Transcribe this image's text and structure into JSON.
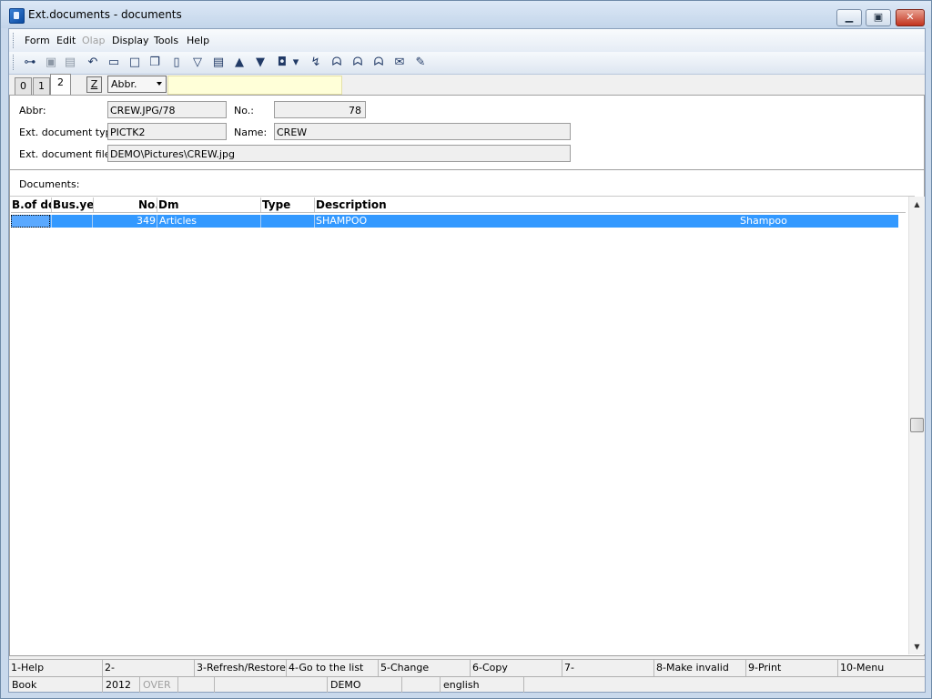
{
  "window": {
    "title": "Ext.documents - documents",
    "min_glyph": "▁",
    "max_glyph": "▣",
    "close_glyph": "✕"
  },
  "menu": [
    {
      "label": "Form",
      "enabled": true
    },
    {
      "label": "Edit",
      "enabled": true
    },
    {
      "label": "Olap",
      "enabled": false
    },
    {
      "label": "Display",
      "enabled": true
    },
    {
      "label": "Tools",
      "enabled": true
    },
    {
      "label": "Help",
      "enabled": true
    }
  ],
  "toolbar": [
    {
      "icon": "tree-icon",
      "glyph": "⊶"
    },
    {
      "icon": "save-icon",
      "glyph": "▣"
    },
    {
      "icon": "save-as-icon",
      "glyph": "▤"
    },
    {
      "icon": "undo-icon",
      "glyph": "↶"
    },
    {
      "icon": "open-folder-icon",
      "glyph": "▭"
    },
    {
      "icon": "new-document-icon",
      "glyph": "□"
    },
    {
      "icon": "copy-icon",
      "glyph": "❐"
    },
    {
      "icon": "book-icon",
      "glyph": "▯"
    },
    {
      "icon": "filter-icon",
      "glyph": "▽"
    },
    {
      "icon": "filter-list-icon",
      "glyph": "▤"
    },
    {
      "icon": "arrow-up-icon",
      "glyph": "▲"
    },
    {
      "icon": "arrow-down-icon",
      "glyph": "▼"
    },
    {
      "icon": "camera-icon",
      "glyph": "◘"
    },
    {
      "icon": "dropdown-arrow-icon",
      "glyph": "▾"
    },
    {
      "icon": "import-icon",
      "glyph": "↯"
    },
    {
      "icon": "binoculars-icon",
      "glyph": "ᗣ"
    },
    {
      "icon": "find-next-icon",
      "glyph": "ᗣ"
    },
    {
      "icon": "find-prev-icon",
      "glyph": "ᗣ"
    },
    {
      "icon": "mail-icon",
      "glyph": "✉"
    },
    {
      "icon": "notepad-icon",
      "glyph": "✎"
    }
  ],
  "tabs": [
    "0",
    "1",
    "2"
  ],
  "active_tab": "2",
  "tab_z_label": "Z",
  "sort_combo": {
    "value": "Abbr."
  },
  "search": {
    "value": ""
  },
  "form": {
    "abbr_label": "Abbr:",
    "abbr_value": "CREW.JPG/78",
    "no_label": "No.:",
    "no_value": "78",
    "type_label": "Ext. document type",
    "type_value": "PICTK2",
    "name_label": "Name:",
    "name_value": "CREW",
    "file_label": "Ext. document file:",
    "file_value": "DEMO\\Pictures\\CREW.jpg"
  },
  "documents": {
    "label": "Documents:",
    "columns": {
      "bofd": "B.of do",
      "busyear": "Bus.ye",
      "no": "No.",
      "dm": "Dm",
      "type": "Type",
      "description": "Description"
    },
    "rows": [
      {
        "bofd": "",
        "busyear": "",
        "no": "349",
        "dm": "Articles",
        "type": "",
        "description": "SHAMPOO",
        "extra": "Shampoo"
      }
    ],
    "scroll_up": "▲",
    "scroll_down": "▼"
  },
  "fkeys": [
    "1-Help",
    "2-",
    "3-Refresh/Restore",
    "4-Go to the list",
    "5-Change",
    "6-Copy",
    "7-",
    "8-Make invalid",
    "9-Print",
    "10-Menu"
  ],
  "status": {
    "book": "Book",
    "year": "2012",
    "mode": "OVER",
    "empty1": "",
    "empty2": "",
    "database": "DEMO",
    "empty3": "",
    "language": "english"
  }
}
